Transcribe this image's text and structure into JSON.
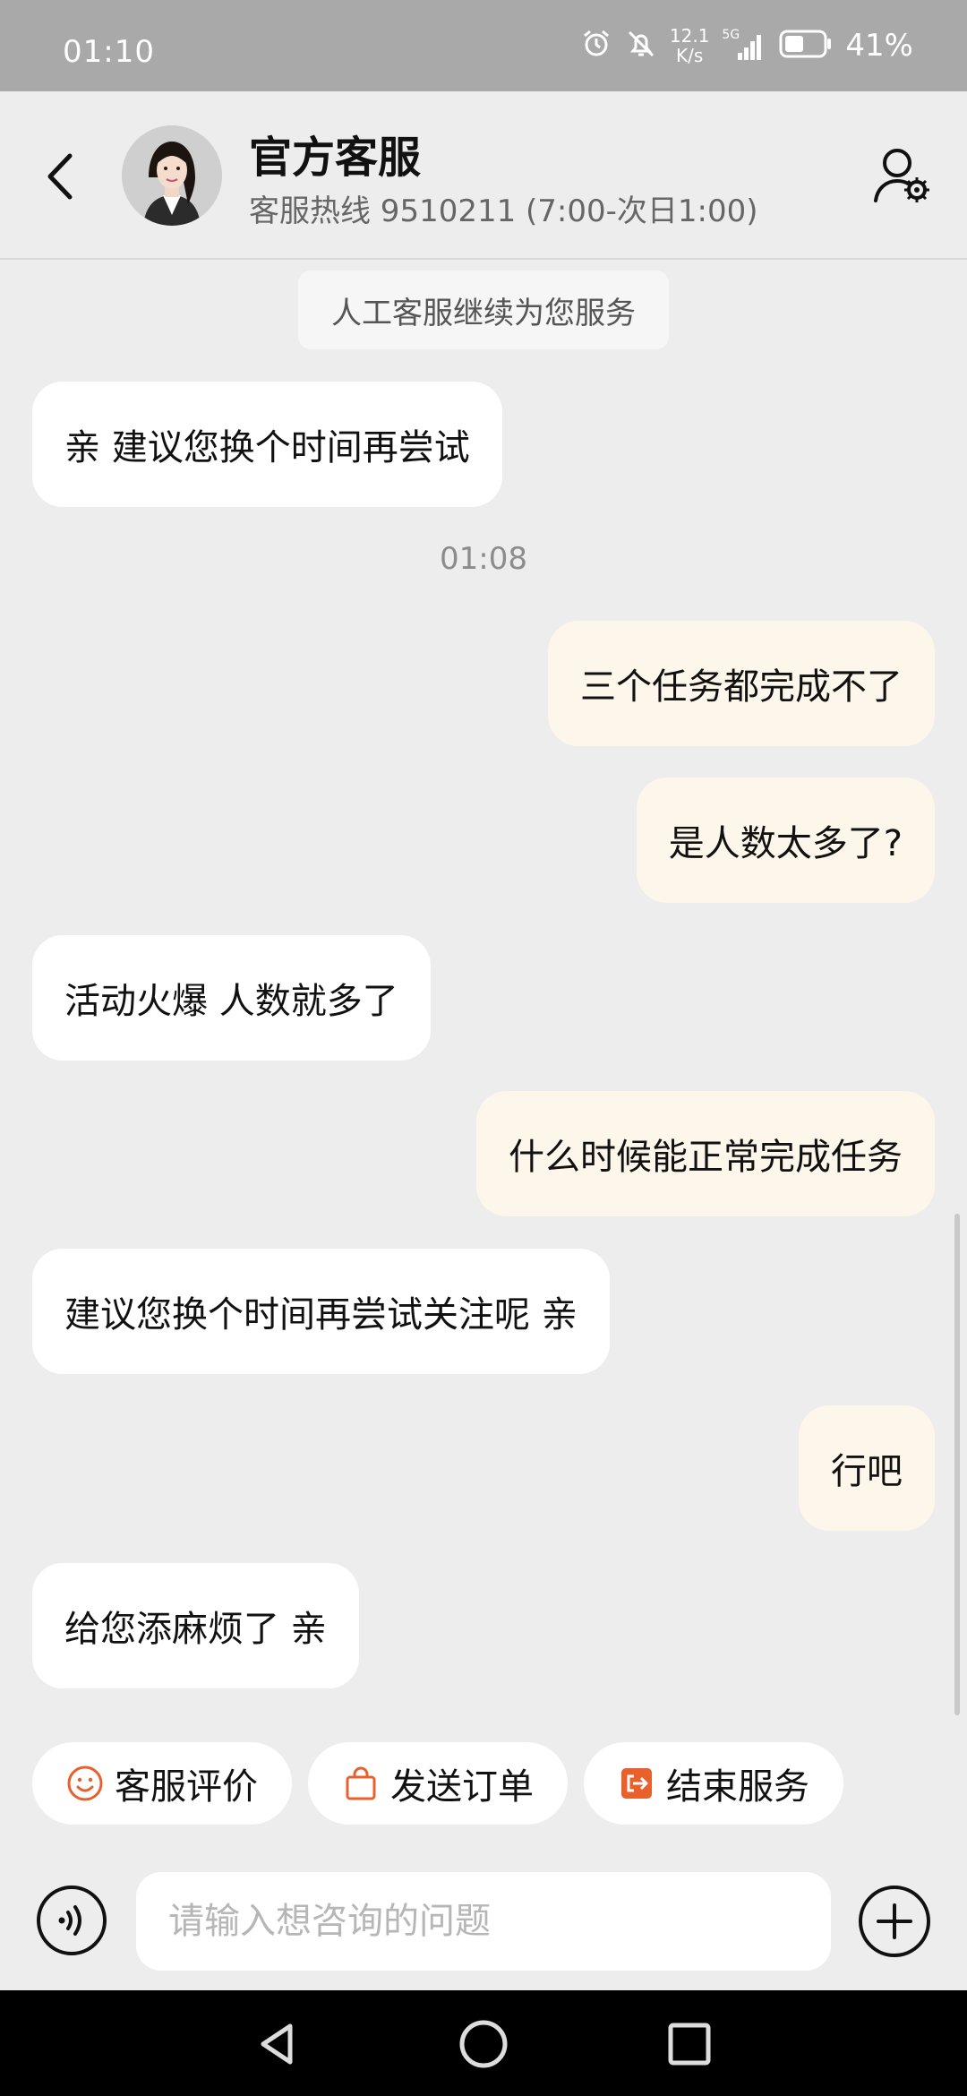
{
  "status_bar": {
    "time": "01:10",
    "net_speed_value": "12.1",
    "net_speed_unit": "K/s",
    "signal_label": "5G",
    "battery_percent": "41%"
  },
  "header": {
    "title": "官方客服",
    "subtitle": "客服热线 9510211 (7:00-次日1:00)"
  },
  "chat": {
    "system_notice": "人工客服继续为您服务",
    "timestamp": "01:08",
    "messages": [
      {
        "side": "left",
        "text": "亲 建议您换个时间再尝试"
      },
      {
        "side": "right",
        "text": "三个任务都完成不了"
      },
      {
        "side": "right",
        "text": "是人数太多了?"
      },
      {
        "side": "left",
        "text": "活动火爆 人数就多了"
      },
      {
        "side": "right",
        "text": "什么时候能正常完成任务"
      },
      {
        "side": "left",
        "text": "建议您换个时间再尝试关注呢 亲"
      },
      {
        "side": "right",
        "text": "行吧"
      },
      {
        "side": "left",
        "text": "给您添麻烦了  亲"
      }
    ]
  },
  "quick_actions": [
    {
      "label": "客服评价",
      "icon": "smiley-icon"
    },
    {
      "label": "发送订单",
      "icon": "shopping-bag-icon"
    },
    {
      "label": "结束服务",
      "icon": "exit-icon"
    }
  ],
  "input": {
    "placeholder": "请输入想咨询的问题",
    "value": ""
  },
  "colors": {
    "accent": "#e8602c",
    "bubble_right": "#fdf6ea",
    "bubble_left": "#ffffff",
    "background": "#ededed"
  }
}
